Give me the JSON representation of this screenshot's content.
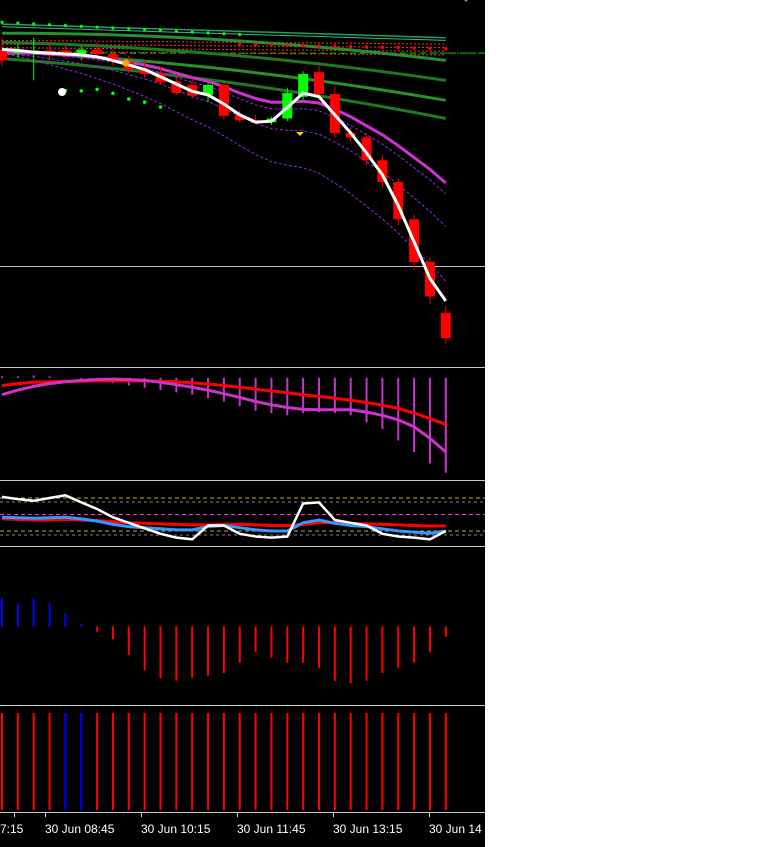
{
  "window": {
    "colors": {
      "background": "#000000",
      "bull": "#00ff00",
      "bear": "#ff0000",
      "ma_white": "#ffffff",
      "ma_magenta": "#cc33cc",
      "band_green": "#1a7a1a",
      "band_red": "#ff3030",
      "osc_blue": "#3399ff"
    }
  },
  "price_pane": {
    "candles": [
      {
        "o": 1.262,
        "h": 1.274,
        "l": 1.244,
        "c": 1.25
      },
      {
        "o": 1.258,
        "h": 1.268,
        "l": 1.253,
        "c": 1.261
      },
      {
        "o": 1.26,
        "h": 1.275,
        "l": 1.228,
        "c": 1.261
      },
      {
        "o": 1.261,
        "h": 1.27,
        "l": 1.25,
        "c": 1.259
      },
      {
        "o": 1.261,
        "h": 1.268,
        "l": 1.252,
        "c": 1.256
      },
      {
        "o": 1.256,
        "h": 1.266,
        "l": 1.25,
        "c": 1.262
      },
      {
        "o": 1.262,
        "h": 1.27,
        "l": 1.25,
        "c": 1.257
      },
      {
        "o": 1.257,
        "h": 1.262,
        "l": 1.244,
        "c": 1.25
      },
      {
        "o": 1.248,
        "h": 1.255,
        "l": 1.236,
        "c": 1.24
      },
      {
        "o": 1.241,
        "h": 1.25,
        "l": 1.231,
        "c": 1.235
      },
      {
        "o": 1.236,
        "h": 1.243,
        "l": 1.224,
        "c": 1.226
      },
      {
        "o": 1.227,
        "h": 1.235,
        "l": 1.212,
        "c": 1.214
      },
      {
        "o": 1.223,
        "h": 1.23,
        "l": 1.208,
        "c": 1.211
      },
      {
        "o": 1.212,
        "h": 1.225,
        "l": 1.204,
        "c": 1.223
      },
      {
        "o": 1.223,
        "h": 1.226,
        "l": 1.185,
        "c": 1.189
      },
      {
        "o": 1.19,
        "h": 1.195,
        "l": 1.182,
        "c": 1.184
      },
      {
        "o": 1.184,
        "h": 1.19,
        "l": 1.18,
        "c": 1.181
      },
      {
        "o": 1.182,
        "h": 1.188,
        "l": 1.179,
        "c": 1.186
      },
      {
        "o": 1.186,
        "h": 1.22,
        "l": 1.183,
        "c": 1.214
      },
      {
        "o": 1.21,
        "h": 1.238,
        "l": 1.207,
        "c": 1.235
      },
      {
        "o": 1.237,
        "h": 1.244,
        "l": 1.21,
        "c": 1.213
      },
      {
        "o": 1.213,
        "h": 1.222,
        "l": 1.165,
        "c": 1.17
      },
      {
        "o": 1.17,
        "h": 1.176,
        "l": 1.16,
        "c": 1.165
      },
      {
        "o": 1.165,
        "h": 1.17,
        "l": 1.135,
        "c": 1.14
      },
      {
        "o": 1.14,
        "h": 1.146,
        "l": 1.11,
        "c": 1.116
      },
      {
        "o": 1.116,
        "h": 1.12,
        "l": 1.068,
        "c": 1.075
      },
      {
        "o": 1.075,
        "h": 1.08,
        "l": 1.02,
        "c": 1.028
      },
      {
        "o": 1.028,
        "h": 1.033,
        "l": 0.982,
        "c": 0.99
      },
      {
        "o": 0.972,
        "h": 0.98,
        "l": 0.938,
        "c": 0.944
      }
    ],
    "ma_white": [
      1.262,
      1.261,
      1.259,
      1.258,
      1.257,
      1.256,
      1.254,
      1.25,
      1.245,
      1.24,
      1.232,
      1.224,
      1.216,
      1.212,
      1.202,
      1.19,
      1.182,
      1.183,
      1.198,
      1.214,
      1.21,
      1.19,
      1.17,
      1.148,
      1.124,
      1.09,
      1.05,
      1.01,
      0.985
    ],
    "ma_magenta": [
      1.258,
      1.258,
      1.258,
      1.257,
      1.256,
      1.255,
      1.253,
      1.251,
      1.248,
      1.245,
      1.241,
      1.236,
      1.231,
      1.227,
      1.221,
      1.214,
      1.208,
      1.204,
      1.204,
      1.205,
      1.203,
      1.196,
      1.188,
      1.178,
      1.168,
      1.156,
      1.143,
      1.13,
      1.115
    ],
    "band_green_offsets": [
      0.018,
      0.008,
      -0.002,
      -0.01
    ],
    "band_red_level_start": 1.272,
    "band_red_level_end": 1.268,
    "green_top_start": 1.29,
    "green_top_end": 1.275,
    "horizontal_level": 1.023,
    "dashed_level": 1.258
  },
  "osc1_pane": {
    "red": [
      -0.1,
      -0.06,
      -0.03,
      -0.02,
      -0.01,
      -0.01,
      0.0,
      0.0,
      0.0,
      0.0,
      -0.01,
      -0.02,
      -0.04,
      -0.07,
      -0.1,
      -0.14,
      -0.18,
      -0.22,
      -0.26,
      -0.3,
      -0.34,
      -0.38,
      -0.42,
      -0.47,
      -0.53,
      -0.6,
      -0.7,
      -0.82,
      -0.95
    ],
    "magenta": [
      -0.3,
      -0.2,
      -0.12,
      -0.06,
      -0.02,
      0.01,
      0.03,
      0.04,
      0.03,
      0.01,
      -0.03,
      -0.08,
      -0.14,
      -0.2,
      -0.28,
      -0.36,
      -0.45,
      -0.52,
      -0.58,
      -0.62,
      -0.63,
      -0.63,
      -0.63,
      -0.68,
      -0.75,
      -0.85,
      -1.0,
      -1.25,
      -1.55
    ],
    "histogram": [
      0.1,
      0.1,
      0.12,
      0.1,
      0.06,
      0.02,
      -0.02,
      -0.05,
      -0.1,
      -0.15,
      -0.2,
      -0.25,
      -0.3,
      -0.38,
      -0.45,
      -0.55,
      -0.65,
      -0.7,
      -0.75,
      -0.7,
      -0.68,
      -0.7,
      -0.75,
      -0.9,
      -1.05,
      -1.3,
      -1.55,
      -1.8,
      -2.0
    ]
  },
  "osc2_pane": {
    "levels": [
      80,
      50,
      20
    ],
    "white": [
      82,
      78,
      75,
      80,
      85,
      72,
      60,
      45,
      35,
      25,
      15,
      8,
      5,
      30,
      30,
      15,
      10,
      8,
      10,
      70,
      72,
      40,
      35,
      30,
      15,
      10,
      8,
      5,
      20
    ],
    "blue": [
      45,
      44,
      43,
      44,
      45,
      42,
      38,
      32,
      28,
      26,
      24,
      22,
      22,
      28,
      30,
      26,
      22,
      20,
      20,
      35,
      40,
      34,
      30,
      28,
      24,
      20,
      18,
      16,
      20
    ],
    "red": [
      42,
      41,
      40,
      40,
      41,
      40,
      39,
      37,
      35,
      34,
      33,
      32,
      31,
      31,
      32,
      32,
      31,
      30,
      30,
      32,
      35,
      35,
      34,
      33,
      32,
      31,
      30,
      29,
      29
    ]
  },
  "osc3_pane": {
    "values": [
      0.55,
      0.45,
      0.55,
      0.45,
      0.25,
      0.05,
      -0.1,
      -0.25,
      -0.55,
      -0.85,
      -1.0,
      -1.05,
      -1.0,
      -0.95,
      -0.9,
      -0.7,
      -0.5,
      -0.6,
      -0.7,
      -0.7,
      -0.8,
      -1.05,
      -1.1,
      -1.05,
      -0.9,
      -0.8,
      -0.7,
      -0.5,
      -0.2
    ]
  },
  "osc4_pane": {
    "colors": [
      "red",
      "red",
      "red",
      "red",
      "blue",
      "blue",
      "red",
      "red",
      "red",
      "red",
      "red",
      "red",
      "red",
      "red",
      "red",
      "red",
      "red",
      "red",
      "red",
      "red",
      "red",
      "red",
      "red",
      "red",
      "red",
      "red",
      "red",
      "red",
      "red"
    ]
  },
  "time_axis": {
    "labels": [
      "7:15",
      "30 Jun 08:45",
      "30 Jun 10:15",
      "30 Jun 11:45",
      "30 Jun 13:15",
      "30 Jun 14"
    ]
  }
}
